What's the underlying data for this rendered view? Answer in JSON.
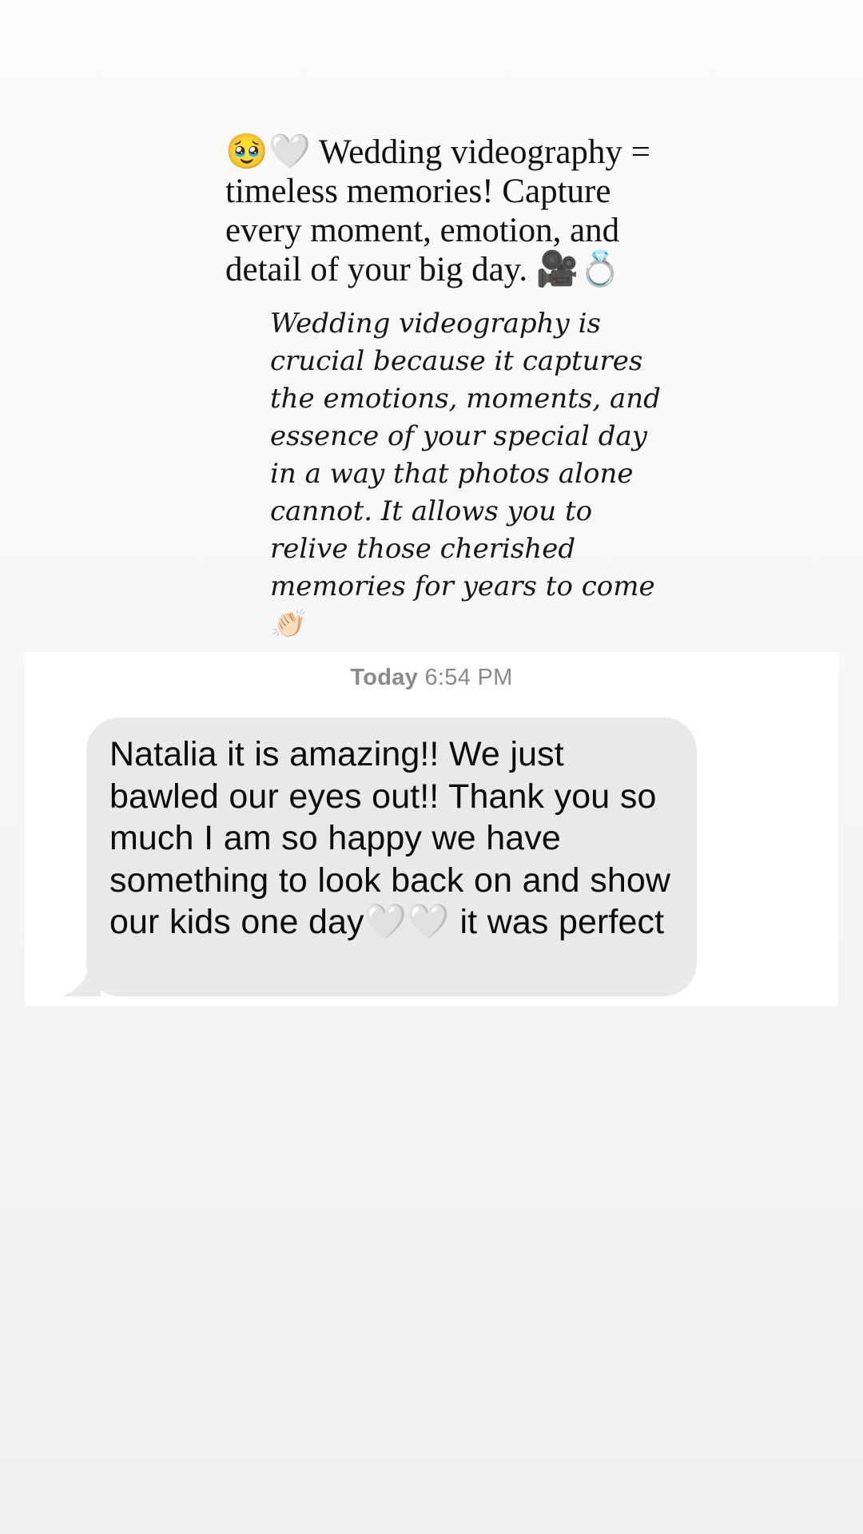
{
  "story": {
    "headline": "🥹🤍 Wedding videography = timeless memories! Capture every moment, emotion, and detail of your big day. 🎥💍",
    "body": "Wedding videography is crucial because it captures the emotions, moments, and essence of your special day in a way that photos alone cannot. It allows you to relive those cherished memories for years to come👏🏻"
  },
  "conversation": {
    "timestamp_day": "Today",
    "timestamp_time": "6:54 PM",
    "message": "Natalia it is amazing!! We just bawled our eyes out!! Thank you so much I am so happy we have something to look back on and show our kids one day🤍🤍 it was perfect"
  },
  "colors": {
    "bubble": "#e9e9eb",
    "timestamp": "#8a8a8e",
    "card": "#ffffff"
  }
}
